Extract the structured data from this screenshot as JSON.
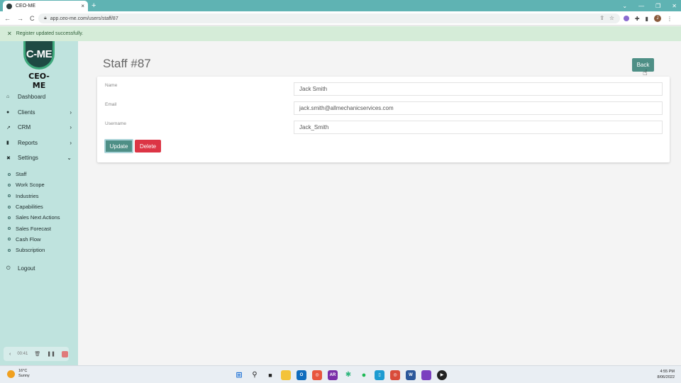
{
  "browser": {
    "tab_title": "CEO-ME",
    "tab_close": "×",
    "new_tab": "+",
    "url": "app.ceo-me.com/users/staff/87",
    "window_controls": [
      "⌄",
      "—",
      "❐",
      "✕"
    ],
    "nav": [
      "←",
      "→",
      "C"
    ],
    "profile_initial": "J"
  },
  "notification": {
    "close": "✕",
    "message": "Register updated successfully."
  },
  "sidebar": {
    "logo_mark": "C-ME",
    "logo_text": "CEO-ME",
    "items": [
      {
        "label": "Dashboard",
        "icon": "home-icon",
        "glyph": "⌂",
        "chevron": ""
      },
      {
        "label": "Clients",
        "icon": "clients-icon",
        "glyph": "●",
        "chevron": "›"
      },
      {
        "label": "CRM",
        "icon": "chart-icon",
        "glyph": "↗",
        "chevron": "›"
      },
      {
        "label": "Reports",
        "icon": "reports-icon",
        "glyph": "▮",
        "chevron": "›"
      },
      {
        "label": "Settings",
        "icon": "settings-icon",
        "glyph": "✖",
        "chevron": "⌄"
      }
    ],
    "settings_sub": [
      "Staff",
      "Work Scope",
      "Industries",
      "Capabilities",
      "Sales Next Actions",
      "Sales Forecast",
      "Cash Flow",
      "Subscription"
    ],
    "logout": {
      "label": "Logout",
      "glyph": "⏻"
    },
    "recorder": {
      "time": "00:41"
    }
  },
  "main": {
    "title": "Staff #87",
    "back_label": "Back",
    "fields": [
      {
        "label": "Name",
        "value": "Jack Smith"
      },
      {
        "label": "Email",
        "value": "jack.smith@allmechanicservices.com"
      },
      {
        "label": "Username",
        "value": "Jack_Smith"
      }
    ],
    "update_label": "Update",
    "delete_label": "Delete"
  },
  "taskbar": {
    "temperature": "16°C",
    "condition": "Sunny",
    "time": "4:55 PM",
    "date": "8/06/2022",
    "app_glyphs": [
      "⊞",
      "⚲",
      "■",
      "▬",
      "O",
      "◎",
      "AR",
      "✱",
      "●",
      "▯",
      "◎",
      "W",
      "▰",
      "▶"
    ]
  },
  "colors": {
    "accent": "#4e8f86",
    "sidebar_bg": "#bfe3de",
    "tab_strip": "#5fb3b3",
    "danger": "#dc3545",
    "success_bar": "#d5ecd8"
  }
}
